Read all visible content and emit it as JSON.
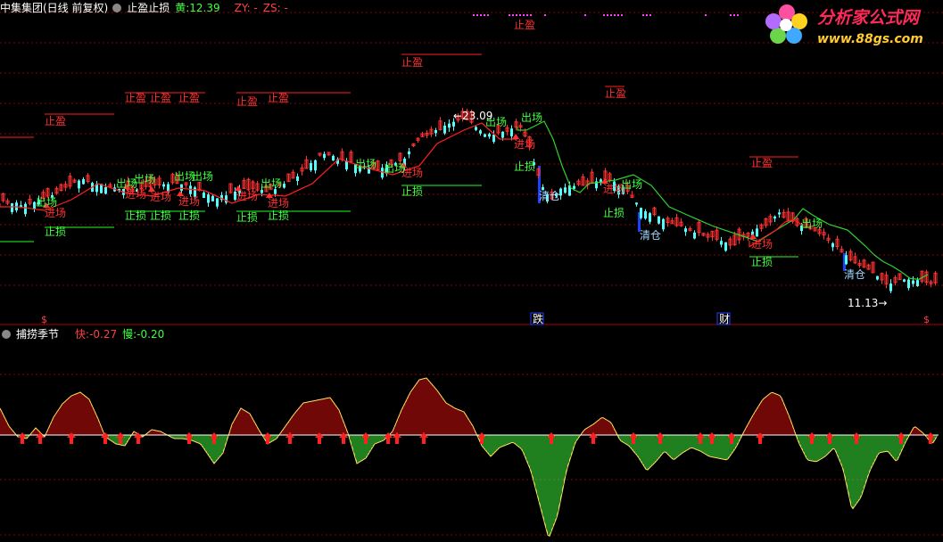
{
  "top_panel": {
    "stock_title": "中集集团(日线 前复权)",
    "indicator_name": "止盈止损",
    "value_label": "黄:",
    "value": "12.39",
    "zy_label": "ZY: -",
    "zs_label": "ZS: -",
    "price_high_label": "23.09",
    "price_low_label": "11.13",
    "markers": {
      "take_profit": "止盈",
      "stop_loss": "止损",
      "enter": "进场",
      "exit": "出场",
      "clear": "清仓"
    },
    "event_labels": {
      "fall": "跌",
      "wealth": "财"
    }
  },
  "bottom_panel": {
    "indicator_name": "捕捞季节",
    "fast_label": "快:",
    "fast_value": "-0.27",
    "slow_label": "慢:",
    "slow_value": "-0.20"
  },
  "logo": {
    "title": "分析家公式网",
    "url": "www.88gs.com"
  },
  "colors": {
    "up": "#ff3232",
    "down": "#54fcfc",
    "green": "#40ff40",
    "red_line": "#ff2020",
    "ma_green": "#30d030",
    "grid": "#8b0000",
    "magenta": "#ff40ff",
    "yellow": "#ffff40",
    "blue": "#2040ff"
  }
}
